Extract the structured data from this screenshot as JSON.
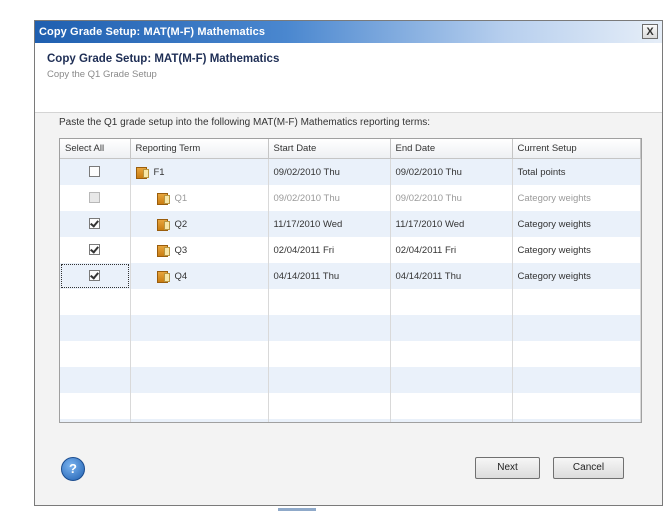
{
  "window": {
    "title": "Copy Grade Setup: MAT(M-F) Mathematics",
    "close_label": "X"
  },
  "header": {
    "title": "Copy Grade Setup: MAT(M-F) Mathematics",
    "subtitle": "Copy the Q1 Grade Setup"
  },
  "instruction": "Paste the Q1 grade setup into the following MAT(M-F) Mathematics reporting terms:",
  "table": {
    "columns": [
      "Select All",
      "Reporting Term",
      "Start Date",
      "End Date",
      "Current Setup"
    ],
    "rows": [
      {
        "checked": false,
        "disabled": false,
        "term": "F1",
        "start": "09/02/2010 Thu",
        "end": "09/02/2010 Thu",
        "setup": "Total points"
      },
      {
        "checked": false,
        "disabled": true,
        "term": "Q1",
        "start": "09/02/2010 Thu",
        "end": "09/02/2010 Thu",
        "setup": "Category weights"
      },
      {
        "checked": true,
        "disabled": false,
        "term": "Q2",
        "start": "11/17/2010 Wed",
        "end": "11/17/2010 Wed",
        "setup": "Category weights"
      },
      {
        "checked": true,
        "disabled": false,
        "term": "Q3",
        "start": "02/04/2011 Fri",
        "end": "02/04/2011 Fri",
        "setup": "Category weights"
      },
      {
        "checked": true,
        "disabled": false,
        "term": "Q4",
        "start": "04/14/2011 Thu",
        "end": "04/14/2011 Thu",
        "setup": "Category weights"
      }
    ]
  },
  "buttons": {
    "help": "?",
    "next": "Next",
    "cancel": "Cancel"
  },
  "colors": {
    "title_bar": "#1f5fb0",
    "row_alt": "#eaf1fa",
    "folder": "#d08a1c"
  },
  "icons": {
    "term": "folder-icon",
    "help": "help-icon",
    "close": "close-icon"
  }
}
